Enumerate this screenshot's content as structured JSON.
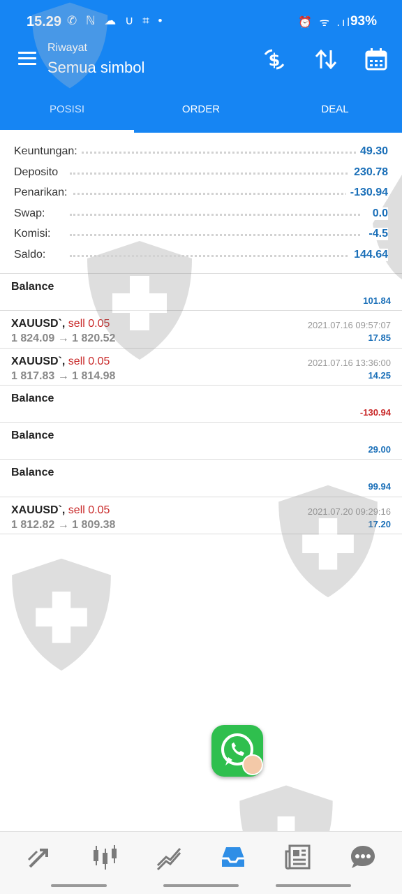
{
  "status_bar": {
    "time": "15.29",
    "left_icons": "✆ ℕ ☁ ∪ ⌗ •",
    "right_icons": "⏰ ᯤ .ıl",
    "battery": "93%"
  },
  "header": {
    "subtitle": "Riwayat",
    "title": "Semua simbol",
    "icons": [
      "menu-icon",
      "deposit-icon",
      "sort-icon",
      "calendar-icon"
    ]
  },
  "tabs": [
    {
      "label": "POSISI",
      "active": true
    },
    {
      "label": "ORDER",
      "active": false
    },
    {
      "label": "DEAL",
      "active": false
    }
  ],
  "summary": [
    {
      "label": "Keuntungan:",
      "value": "49.30"
    },
    {
      "label": "Deposito",
      "value": "230.78"
    },
    {
      "label": "Penarikan:",
      "value": "-130.94"
    },
    {
      "label": "Swap:",
      "value": "0.0"
    },
    {
      "label": "Komisi:",
      "value": "-4.5"
    },
    {
      "label": "Saldo:",
      "value": "144.64"
    }
  ],
  "deals": [
    {
      "name": "Balance",
      "side": "",
      "prices": "",
      "date": "",
      "profit": "101.84",
      "negative": false
    },
    {
      "name": "XAUUSD`,",
      "side": "sell 0.05",
      "prices": "1 824.09 → 1 820.52",
      "date": "2021.07.16 09:57:07",
      "profit": "17.85",
      "negative": false
    },
    {
      "name": "XAUUSD`,",
      "side": "sell 0.05",
      "prices": "1 817.83 → 1 814.98",
      "date": "2021.07.16 13:36:00",
      "profit": "14.25",
      "negative": false
    },
    {
      "name": "Balance",
      "side": "",
      "prices": "",
      "date": "",
      "profit": "-130.94",
      "negative": true
    },
    {
      "name": "Balance",
      "side": "",
      "prices": "",
      "date": "",
      "profit": "29.00",
      "negative": false
    },
    {
      "name": "Balance",
      "side": "",
      "prices": "",
      "date": "",
      "profit": "99.94",
      "negative": false
    },
    {
      "name": "XAUUSD`,",
      "side": "sell 0.05",
      "prices": "1 812.82 → 1 809.38",
      "date": "2021.07.20 09:29:16",
      "profit": "17.20",
      "negative": false
    }
  ],
  "bottom_nav": [
    "trade-arrows-icon",
    "candlestick-chart-icon",
    "trend-chart-icon",
    "history-inbox-icon",
    "news-icon",
    "chat-icon"
  ],
  "colors": {
    "accent": "#1685f3",
    "profit": "#1a6fb8",
    "loss": "#c82727"
  }
}
